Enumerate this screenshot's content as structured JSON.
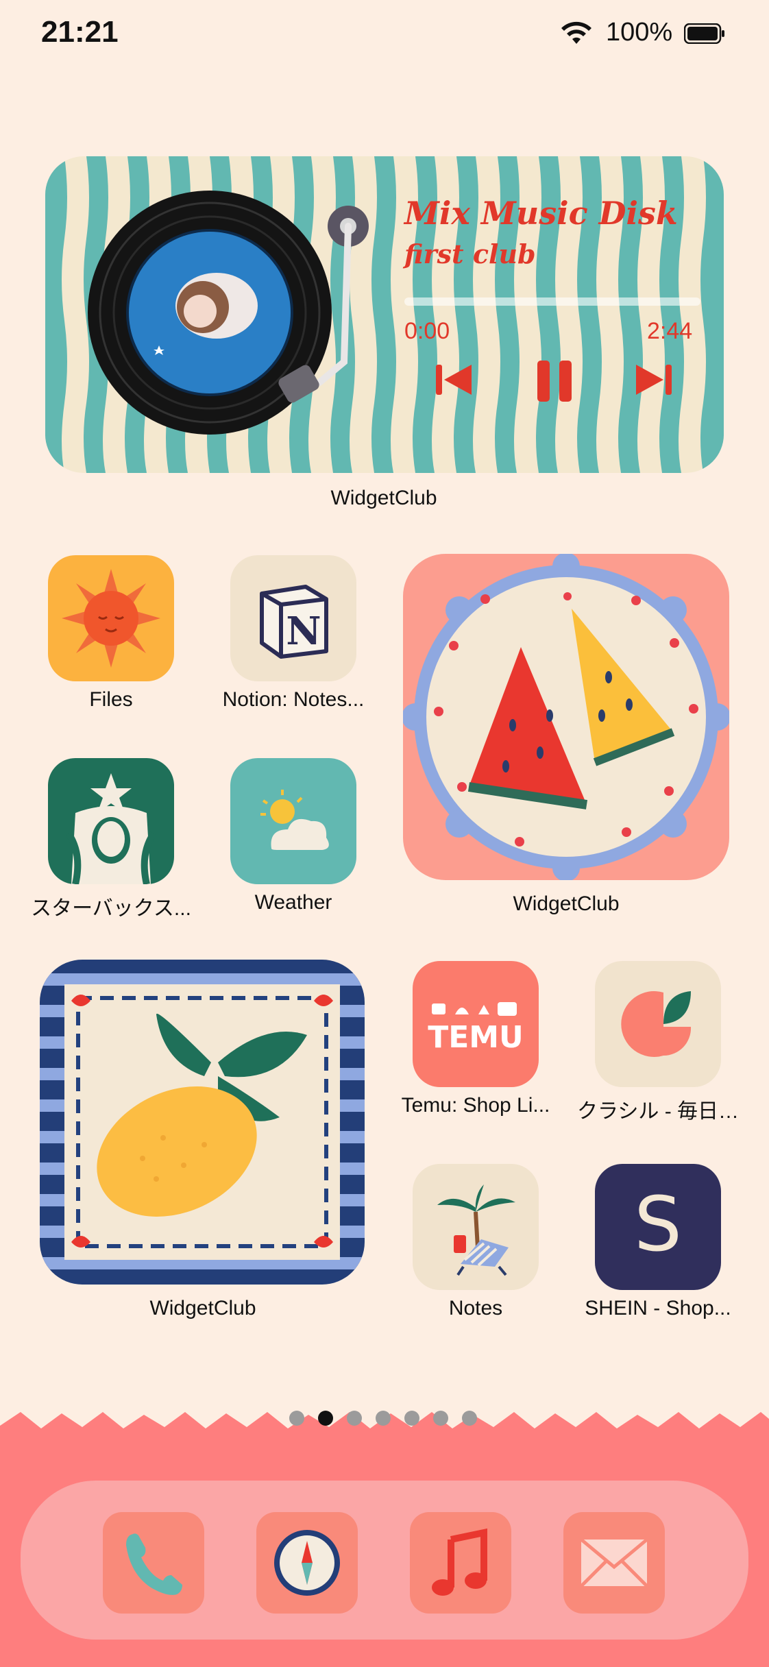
{
  "status": {
    "time": "21:21",
    "battery": "100%"
  },
  "music_widget": {
    "title": "Mix Music Disk",
    "subtitle": "first club",
    "time_start": "0:00",
    "time_end": "2:44",
    "progress": 0.0,
    "label": "WidgetClub"
  },
  "apps": [
    {
      "name": "Files",
      "icon": "sun-icon"
    },
    {
      "name": "Notion: Notes...",
      "icon": "notion-icon"
    },
    {
      "name": "スターバックス...",
      "icon": "starbucks-icon"
    },
    {
      "name": "Weather",
      "icon": "weather-icon"
    },
    {
      "name": "Temu: Shop Li...",
      "icon": "temu-icon"
    },
    {
      "name": "クラシル - 毎日…",
      "icon": "kurashiru-icon"
    },
    {
      "name": "Notes",
      "icon": "palm-chair-icon"
    },
    {
      "name": "SHEIN - Shop...",
      "icon": "shein-icon"
    }
  ],
  "widgets": {
    "watermelon_label": "WidgetClub",
    "lemon_label": "WidgetClub"
  },
  "icon_text": {
    "temu": "TEMU",
    "shein": "S",
    "notion": "N"
  },
  "page_indicator": {
    "count": 7,
    "active": 1
  },
  "dock": [
    {
      "icon": "phone-icon"
    },
    {
      "icon": "compass-icon"
    },
    {
      "icon": "music-note-icon"
    },
    {
      "icon": "mail-icon"
    }
  ],
  "colors": {
    "background": "#fdeee2",
    "teal": "#62b8b1",
    "coral": "#fe7e7e",
    "red": "#e1382a"
  }
}
